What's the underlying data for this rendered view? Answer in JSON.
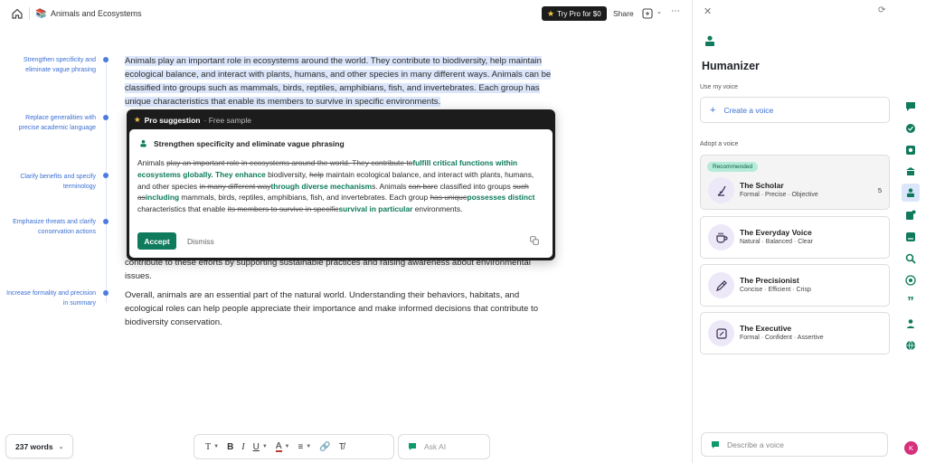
{
  "topbar": {
    "doc_title": "Animals and Ecosystems",
    "pro_label": "Try Pro for $0",
    "share_label": "Share"
  },
  "outline": {
    "items": [
      {
        "label": "Strengthen specificity and eliminate vague phrasing"
      },
      {
        "label": "Replace generalities with precise academic language"
      },
      {
        "label": "Clarify benefits and specify terminology"
      },
      {
        "label": "Emphasize threats and clarify conservation actions"
      },
      {
        "label": "Increase formality and precision in summary"
      }
    ]
  },
  "editor": {
    "para1": "Animals play an important role in ecosystems around the world. They contribute to biodiversity, help maintain ecological balance, and interact with plants, humans, and other species in many different ways. Animals can be classified into groups such as mammals, birds, reptiles, amphibians, fish, and invertebrates. Each group has unique characteristics that enable its members to survive in specific environments.",
    "para_partial": "contribute to these efforts by supporting sustainable practices and raising awareness about environmental issues.",
    "para_last": "Overall, animals are an essential part of the natural world. Understanding their behaviors, habitats, and ecological roles can help people appreciate their importance and make informed decisions that contribute to biodiversity conservation."
  },
  "popup": {
    "title": "Pro suggestion",
    "subtitle": "· Free sample",
    "suggestion_title": "Strengthen specificity and eliminate vague phrasing",
    "segments": [
      {
        "t": "Animals ",
        "k": "n"
      },
      {
        "t": "play an important role in ecosystems around the world. They contribute to",
        "k": "d"
      },
      {
        "t": "fulfill critical functions within ecosystems globally. They enhance",
        "k": "i"
      },
      {
        "t": " biodiversity, ",
        "k": "n"
      },
      {
        "t": "help",
        "k": "d"
      },
      {
        "t": " maintain ecological balance, and interact with plants, humans, and other species ",
        "k": "n"
      },
      {
        "t": "in many different way",
        "k": "d"
      },
      {
        "t": "through diverse mechanism",
        "k": "i"
      },
      {
        "t": "s. Animals ",
        "k": "n"
      },
      {
        "t": "can bar",
        "k": "d"
      },
      {
        "t": "e classified into groups ",
        "k": "n"
      },
      {
        "t": "such as",
        "k": "d"
      },
      {
        "t": "including",
        "k": "i"
      },
      {
        "t": " mammals, birds, reptiles, amphibians, fish, and invertebrates. Each group ",
        "k": "n"
      },
      {
        "t": "has unique",
        "k": "d"
      },
      {
        "t": "possesses distinct",
        "k": "i"
      },
      {
        "t": " characteristics that enable ",
        "k": "n"
      },
      {
        "t": "its members to survive in specific",
        "k": "d"
      },
      {
        "t": "survival in particular",
        "k": "i"
      },
      {
        "t": " environments.",
        "k": "n"
      }
    ],
    "accept_label": "Accept",
    "dismiss_label": "Dismiss"
  },
  "bottom": {
    "word_count": "237 words",
    "ask_ai_placeholder": "Ask AI"
  },
  "panel": {
    "title": "Humanizer",
    "use_my_voice": "Use my voice",
    "create_voice": "Create a voice",
    "adopt_voice": "Adopt a voice",
    "recommended": "Recommended",
    "voices": [
      {
        "name": "The Scholar",
        "traits": "Formal · Precise · Objective",
        "count": "5"
      },
      {
        "name": "The Everyday Voice",
        "traits": "Natural · Balanced · Clear"
      },
      {
        "name": "The Precisionist",
        "traits": "Concise · Efficient · Crisp"
      },
      {
        "name": "The Executive",
        "traits": "Formal · Confident · Assertive"
      }
    ],
    "describe_placeholder": "Describe a voice"
  },
  "user": {
    "initial": "K"
  },
  "colors": {
    "accent_green": "#0f7a5c",
    "link_blue": "#3b6fd4",
    "highlight": "#dbe6fb",
    "pro_dark": "#1c1c1c"
  }
}
